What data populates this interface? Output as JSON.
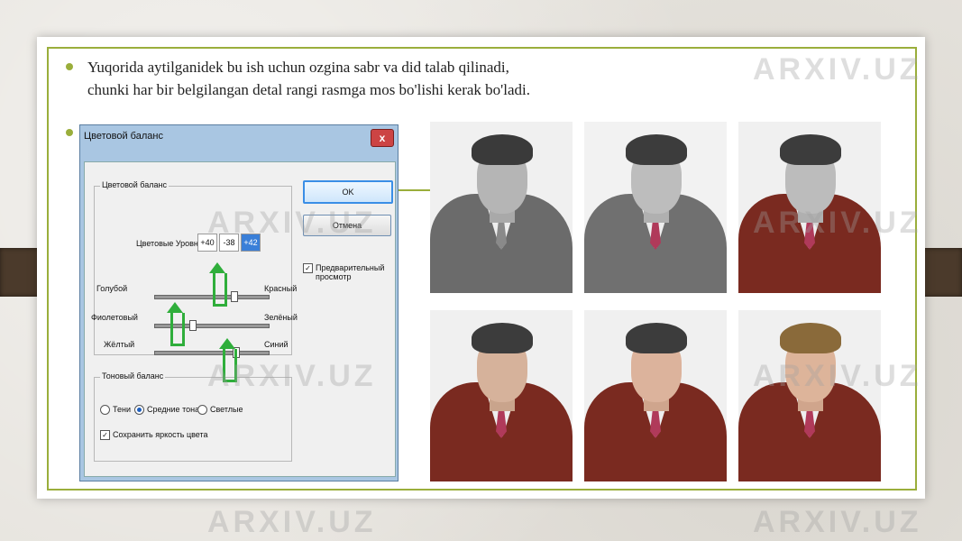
{
  "slide": {
    "bullet_line1": "Yuqorida aytilganidek bu ish uchun ozgina sabr va did talab qilinadi,",
    "bullet_line2": "chunki har bir belgilangan detal rangi rasmga mos bo'lishi kerak bo'ladi."
  },
  "dialog": {
    "title": "Цветовой баланс",
    "close_label": "x",
    "color_group_title": "Цветовой баланс",
    "levels_label": "Цветовые Уровни:",
    "levels": [
      "+40",
      "-38",
      "+42"
    ],
    "sliders": [
      {
        "left": "Голубой",
        "right": "Красный",
        "value": 40
      },
      {
        "left": "Фиолетовый",
        "right": "Зелёный",
        "value": -38
      },
      {
        "left": "Жёлтый",
        "right": "Синий",
        "value": 42
      }
    ],
    "tone_group_title": "Тоновый баланс",
    "tone_options": [
      "Тени",
      "Средние тона",
      "Светлые"
    ],
    "tone_selected": "Средние тона",
    "preserve_luminosity": "Сохранить яркость цвета",
    "ok_label": "OK",
    "cancel_label": "Отмена",
    "preview_label": "Предварительный просмотр"
  },
  "photos": [
    {
      "stage": "grayscale"
    },
    {
      "stage": "grayscale-light"
    },
    {
      "stage": "coat-colored"
    },
    {
      "stage": "coat-face"
    },
    {
      "stage": "coat-face-lips"
    },
    {
      "stage": "full-color"
    }
  ],
  "watermark": "ARXIV.UZ",
  "colors": {
    "accent": "#9aae3b",
    "coat_red": "#7a2a20",
    "coat_gray": "#6b6b6b",
    "arrow_green": "#2fae3b"
  }
}
